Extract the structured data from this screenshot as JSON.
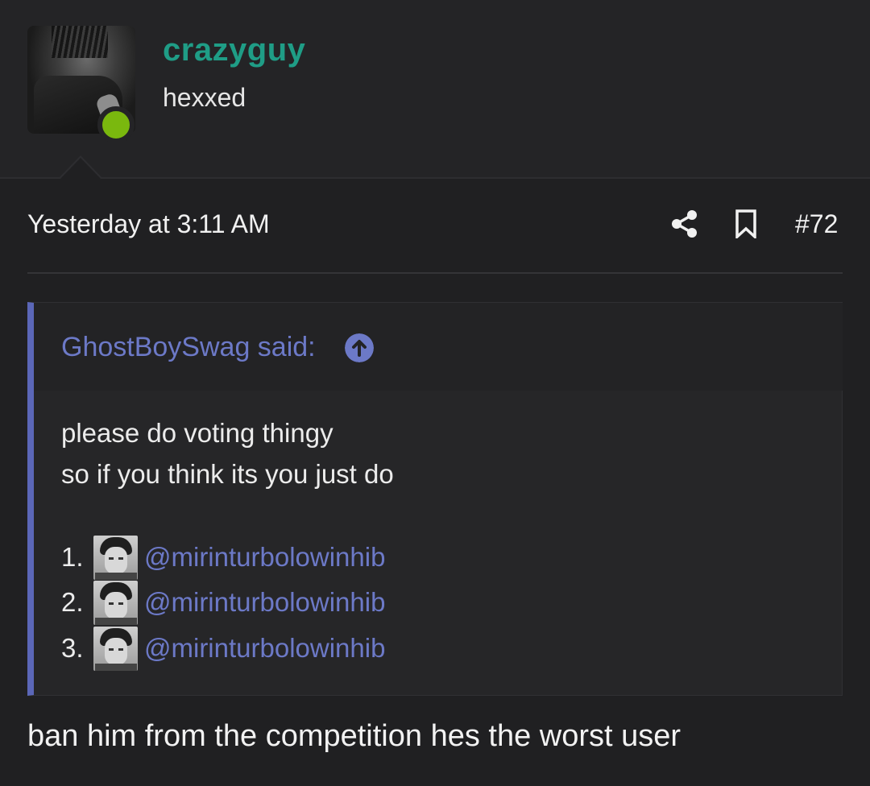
{
  "author": {
    "username": "crazyguy",
    "title": "hexxed",
    "online_color": "#7ab80e",
    "username_color": "#1f9d86"
  },
  "post": {
    "date": "Yesterday at 3:11 AM",
    "number": "#72",
    "body": "ban him from the competition hes the worst user"
  },
  "icons": {
    "share": "share-icon",
    "bookmark": "bookmark-icon",
    "quote_jump": "arrow-up-circle-icon"
  },
  "quote": {
    "author_label": "GhostBoySwag said:",
    "line1": "please do voting thingy",
    "line2": "so if you think its you just do",
    "items": [
      {
        "num": "1.",
        "mention": "@mirinturbolowinhib"
      },
      {
        "num": "2.",
        "mention": "@mirinturbolowinhib"
      },
      {
        "num": "3.",
        "mention": "@mirinturbolowinhib"
      }
    ],
    "accent_color": "#5b67b8",
    "link_color": "#6c79c7"
  }
}
